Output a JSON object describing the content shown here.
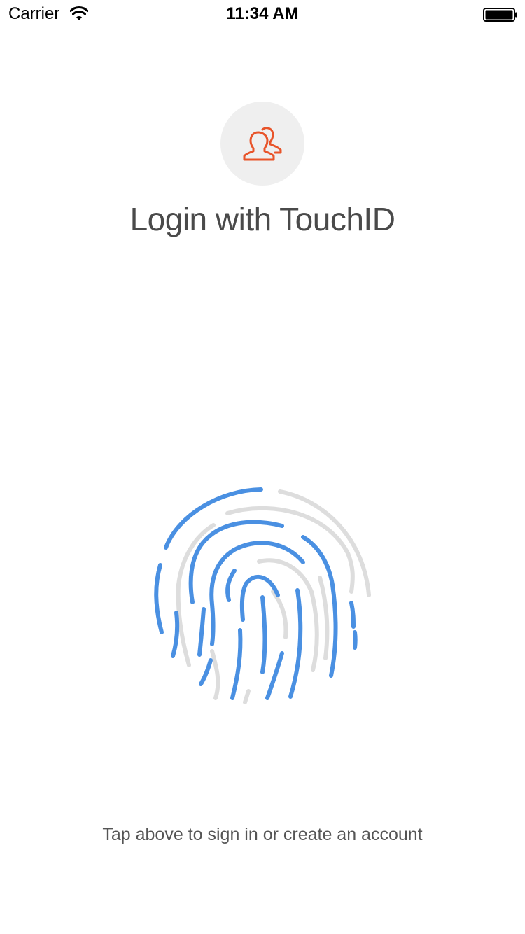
{
  "status_bar": {
    "carrier": "Carrier",
    "time": "11:34 AM"
  },
  "login": {
    "title": "Login with TouchID",
    "hint": "Tap above to sign in or create an account"
  },
  "icons": {
    "avatar": "users-icon",
    "fingerprint": "fingerprint-icon",
    "wifi": "wifi-icon",
    "battery": "battery-icon"
  },
  "colors": {
    "accent": "#e8542a",
    "fingerprint_active": "#4a90e2",
    "fingerprint_inactive": "#dddddd",
    "avatar_bg": "#efefef"
  }
}
